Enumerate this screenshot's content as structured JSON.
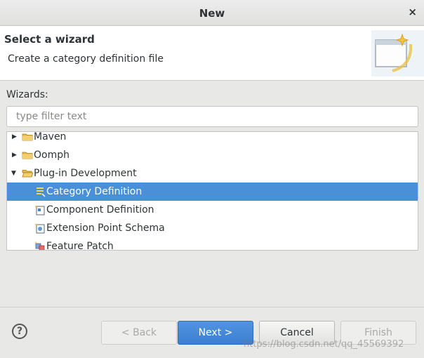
{
  "window": {
    "title": "New",
    "close_glyph": "×"
  },
  "header": {
    "title": "Select a wizard",
    "description": "Create a category definition file",
    "banner_icon": "new-wizard-banner-icon"
  },
  "wizards": {
    "label": "Wizards:",
    "filter_placeholder": "type filter text",
    "filter_value": "",
    "items": [
      {
        "label": "Maven",
        "expanded": false,
        "icon": "folder-icon"
      },
      {
        "label": "Oomph",
        "expanded": false,
        "icon": "folder-icon"
      },
      {
        "label": "Plug-in Development",
        "expanded": true,
        "icon": "folder-open-icon"
      },
      {
        "label": "Category Definition",
        "selected": true,
        "icon": "category-definition-icon"
      },
      {
        "label": "Component Definition",
        "icon": "component-definition-icon"
      },
      {
        "label": "Extension Point Schema",
        "icon": "extension-point-schema-icon"
      },
      {
        "label": "Feature Patch",
        "icon": "feature-patch-icon"
      }
    ]
  },
  "buttons": {
    "help": "?",
    "back": "< Back",
    "next": "Next >",
    "cancel": "Cancel",
    "finish": "Finish"
  },
  "watermark": "https://blog.csdn.net/qq_45569392",
  "colors": {
    "selection": "#4a90d9",
    "primary_button": "#4a8fe0"
  }
}
